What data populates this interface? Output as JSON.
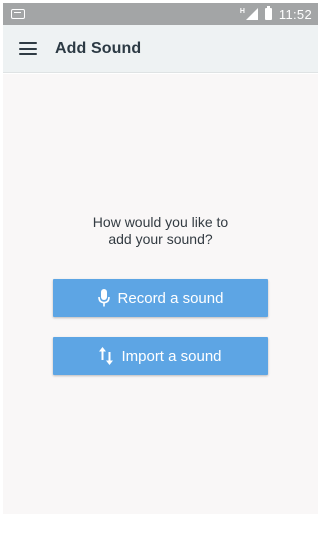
{
  "status_bar": {
    "notification_icon": "image-notification-icon",
    "network_type": "H",
    "time": "11:52"
  },
  "app_bar": {
    "menu_icon": "hamburger-menu-icon",
    "title": "Add Sound"
  },
  "prompt": {
    "line1": "How would you like to",
    "line2": "add your sound?"
  },
  "buttons": {
    "record": {
      "label": "Record a sound",
      "icon": "microphone-icon"
    },
    "import": {
      "label": "Import a sound",
      "icon": "up-down-arrows-icon"
    }
  },
  "colors": {
    "status_bar": "#a3a5a6",
    "app_bar": "#eef2f3",
    "content_bg": "#f9f7f7",
    "button": "#5da5e4",
    "text": "#333b42"
  }
}
